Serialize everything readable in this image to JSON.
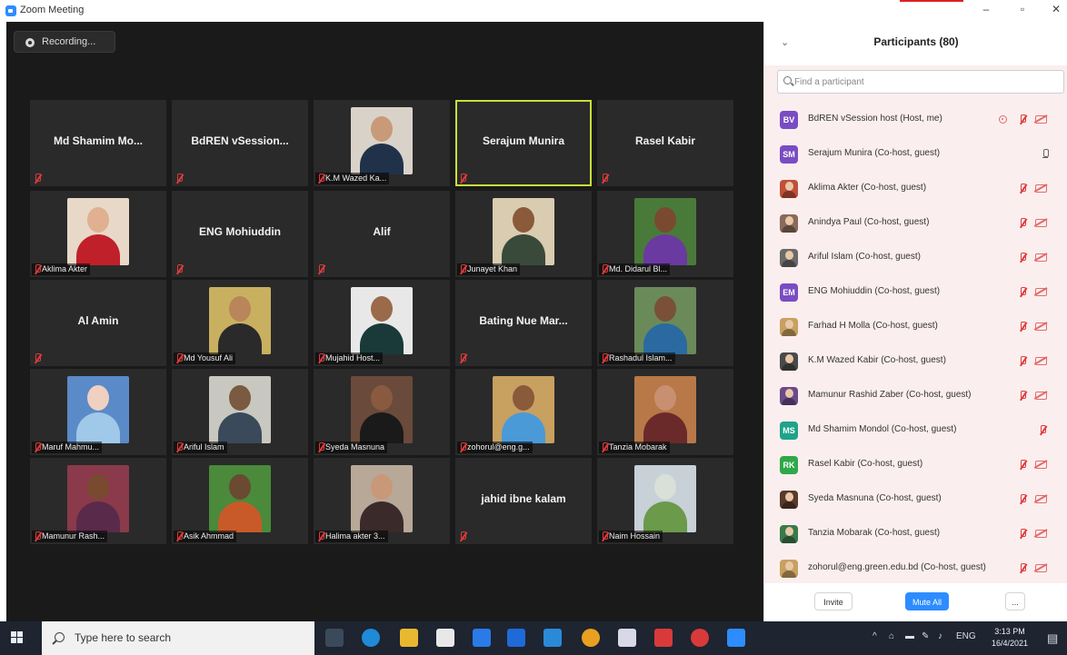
{
  "window": {
    "title": "Zoom Meeting"
  },
  "meeting": {
    "recording_label": "Recording...",
    "tiles": [
      {
        "display": "name",
        "text": "Md Shamim Mo...",
        "label": "",
        "active": false
      },
      {
        "display": "name",
        "text": "BdREN vSession...",
        "label": "",
        "active": false
      },
      {
        "display": "photo",
        "text": "",
        "label": "K.M Wazed Ka...",
        "active": false,
        "skin": "#c89a78",
        "shirt": "#20324a",
        "bg": "#d9d2c8"
      },
      {
        "display": "name",
        "text": "Serajum Munira",
        "label": "",
        "active": true
      },
      {
        "display": "name",
        "text": "Rasel Kabir",
        "label": "",
        "active": false
      },
      {
        "display": "photo",
        "text": "",
        "label": "Aklima Akter",
        "active": false,
        "skin": "#e0b090",
        "shirt": "#c0202a",
        "bg": "#e8d8c8"
      },
      {
        "display": "name",
        "text": "ENG Mohiuddin",
        "label": "",
        "active": false
      },
      {
        "display": "name",
        "text": "Alif",
        "label": "",
        "active": false
      },
      {
        "display": "photo",
        "text": "",
        "label": "Junayet Khan",
        "active": false,
        "skin": "#8a5a3a",
        "shirt": "#3a4a3a",
        "bg": "#d9ccb0"
      },
      {
        "display": "photo",
        "text": "",
        "label": "Md. Didarul Bl...",
        "active": false,
        "skin": "#7a4a30",
        "shirt": "#6a3aa0",
        "bg": "#4a7a3a"
      },
      {
        "display": "name",
        "text": "Al Amin",
        "label": "",
        "active": false
      },
      {
        "display": "photo",
        "text": "",
        "label": "Md Yousuf Ali",
        "active": false,
        "skin": "#b8865a",
        "shirt": "#2a2a2a",
        "bg": "#c8b060"
      },
      {
        "display": "photo",
        "text": "",
        "label": "Mujahid Host...",
        "active": false,
        "skin": "#9a6a4a",
        "shirt": "#1a3a3a",
        "bg": "#e8e8e8"
      },
      {
        "display": "name",
        "text": "Bating Nue Mar...",
        "label": "",
        "active": false
      },
      {
        "display": "photo",
        "text": "",
        "label": "Rashadul Islam...",
        "active": false,
        "skin": "#7a5038",
        "shirt": "#2a6aa0",
        "bg": "#6a8a5a"
      },
      {
        "display": "photo",
        "text": "",
        "label": "Maruf Mahmu...",
        "active": false,
        "skin": "#f0d0c0",
        "shirt": "#a0c8e8",
        "bg": "#5a8ac8"
      },
      {
        "display": "photo",
        "text": "",
        "label": "Ariful Islam",
        "active": false,
        "skin": "#7a5a40",
        "shirt": "#3a4a5a",
        "bg": "#c8c8c0"
      },
      {
        "display": "photo",
        "text": "",
        "label": "Syeda Masnuna",
        "active": false,
        "skin": "#8a5a40",
        "shirt": "#1a1a1a",
        "bg": "#6a4a3a"
      },
      {
        "display": "photo",
        "text": "",
        "label": "zohorul@eng.g...",
        "active": false,
        "skin": "#8a5a3a",
        "shirt": "#4a9ad8",
        "bg": "#c8a060"
      },
      {
        "display": "photo",
        "text": "",
        "label": "Tanzia Mobarak",
        "active": false,
        "skin": "#c89070",
        "shirt": "#6a2a2a",
        "bg": "#b87848"
      },
      {
        "display": "photo",
        "text": "",
        "label": "Mamunur Rash...",
        "active": false,
        "skin": "#7a4a30",
        "shirt": "#5a2a4a",
        "bg": "#8a3a4a"
      },
      {
        "display": "photo",
        "text": "",
        "label": "Asik Ahmmad",
        "active": false,
        "skin": "#6a4a30",
        "shirt": "#c85a2a",
        "bg": "#4a8a3a"
      },
      {
        "display": "photo",
        "text": "",
        "label": "Halima akter 3...",
        "active": false,
        "skin": "#c89878",
        "shirt": "#3a2a2a",
        "bg": "#b8a898"
      },
      {
        "display": "name",
        "text": "jahid ibne kalam",
        "label": "",
        "active": false
      },
      {
        "display": "photo",
        "text": "",
        "label": "Naim Hossain",
        "active": false,
        "skin": "#d8e0d8",
        "shirt": "#6a9a4a",
        "bg": "#c8d0d8"
      }
    ]
  },
  "participants": {
    "title": "Participants (80)",
    "search_placeholder": "Find a participant",
    "rows": [
      {
        "initials": "BV",
        "avatar_color": "#7a4cc4",
        "name": "BdREN vSession host (Host, me)",
        "icons": [
          "rec",
          "mic-off",
          "cam-off"
        ]
      },
      {
        "initials": "SM",
        "avatar_color": "#7a4cc4",
        "name": "Serajum Munira  (Co-host, guest)",
        "icons": [
          "mic-on"
        ]
      },
      {
        "initials": "",
        "avatar_color": "#c0503a",
        "name": "Aklima Akter (Co-host, guest)",
        "icons": [
          "mic-off",
          "cam-off"
        ]
      },
      {
        "initials": "",
        "avatar_color": "#8a6a5a",
        "name": "Anindya Paul (Co-host, guest)",
        "icons": [
          "mic-off",
          "cam-off"
        ]
      },
      {
        "initials": "",
        "avatar_color": "#6a6a6a",
        "name": "Ariful Islam (Co-host, guest)",
        "icons": [
          "mic-off",
          "cam-off"
        ]
      },
      {
        "initials": "EM",
        "avatar_color": "#7a4cc4",
        "name": "ENG Mohiuddin (Co-host, guest)",
        "icons": [
          "mic-off",
          "cam-off"
        ]
      },
      {
        "initials": "",
        "avatar_color": "#c8a060",
        "name": "Farhad H Molla (Co-host, guest)",
        "icons": [
          "mic-off",
          "cam-off"
        ]
      },
      {
        "initials": "",
        "avatar_color": "#4a4a4a",
        "name": "K.M Wazed Kabir (Co-host, guest)",
        "icons": [
          "mic-off",
          "cam-off"
        ]
      },
      {
        "initials": "",
        "avatar_color": "#6a4a8a",
        "name": "Mamunur Rashid Zaber (Co-host, guest)",
        "icons": [
          "mic-off",
          "cam-off"
        ]
      },
      {
        "initials": "MS",
        "avatar_color": "#1fa38a",
        "name": "Md Shamim Mondol (Co-host, guest)",
        "icons": [
          "mic-off"
        ]
      },
      {
        "initials": "RK",
        "avatar_color": "#2fa84a",
        "name": "Rasel Kabir (Co-host, guest)",
        "icons": [
          "mic-off",
          "cam-off"
        ]
      },
      {
        "initials": "",
        "avatar_color": "#5a3a2a",
        "name": "Syeda Masnuna (Co-host, guest)",
        "icons": [
          "mic-off",
          "cam-off"
        ]
      },
      {
        "initials": "",
        "avatar_color": "#3a7a4a",
        "name": "Tanzia Mobarak (Co-host, guest)",
        "icons": [
          "mic-off",
          "cam-off"
        ]
      },
      {
        "initials": "",
        "avatar_color": "#c8a060",
        "name": "zohorul@eng.green.edu.bd (Co-host, guest)",
        "icons": [
          "mic-off",
          "cam-off"
        ]
      }
    ],
    "footer": {
      "invite": "Invite",
      "mute_all": "Mute All",
      "more": "..."
    }
  },
  "taskbar": {
    "search_placeholder": "Type here to search",
    "language": "ENG",
    "time": "3:13 PM",
    "date": "16/4/2021",
    "apps": [
      {
        "name": "task-view-icon",
        "color": "#3a4a5a"
      },
      {
        "name": "edge-icon",
        "color": "#1f8ad8"
      },
      {
        "name": "file-explorer-icon",
        "color": "#e8b830"
      },
      {
        "name": "store-icon",
        "color": "#e8e8e8"
      },
      {
        "name": "dropbox-icon",
        "color": "#2a7ae8"
      },
      {
        "name": "app-bolt-icon",
        "color": "#1f6ad8"
      },
      {
        "name": "mail-icon",
        "color": "#2a8ad8"
      },
      {
        "name": "chrome-icon",
        "color": "#e8a020"
      },
      {
        "name": "paint-icon",
        "color": "#d8d8e8"
      },
      {
        "name": "app-red-icon",
        "color": "#d83a3a"
      },
      {
        "name": "chrome-alt-icon",
        "color": "#d83a3a"
      },
      {
        "name": "zoom-icon",
        "color": "#2d8cff"
      }
    ]
  }
}
